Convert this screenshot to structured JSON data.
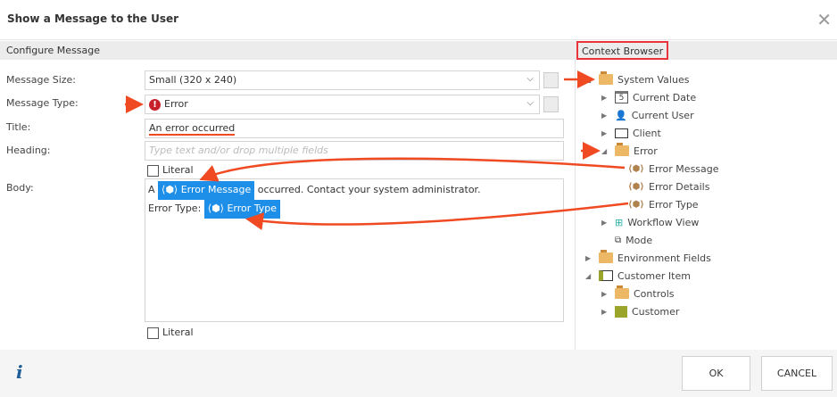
{
  "dialog": {
    "title": "Show a Message to the User"
  },
  "configure": {
    "section_label": "Configure Message",
    "message_size": {
      "label": "Message Size:",
      "value": "Small (320 x 240)"
    },
    "message_type": {
      "label": "Message Type:",
      "value": "Error"
    },
    "title": {
      "label": "Title:",
      "value": "An error occurred"
    },
    "heading": {
      "label": "Heading:",
      "placeholder": "Type text and/or drop multiple fields"
    },
    "literal_label": "Literal",
    "body": {
      "label": "Body:",
      "line1_prefix": "A",
      "token1": "Error Message",
      "line1_suffix": "occurred. Contact your system administrator.",
      "line2_prefix": "Error Type:",
      "token2": "Error Type"
    }
  },
  "context_browser": {
    "label": "Context Browser",
    "items": [
      {
        "label": "System Values",
        "icon": "folder-icon"
      },
      {
        "label": "Current Date",
        "icon": "calendar-icon"
      },
      {
        "label": "Current User",
        "icon": "user-folder-icon"
      },
      {
        "label": "Client",
        "icon": "monitor-icon"
      },
      {
        "label": "Error",
        "icon": "folder-icon"
      },
      {
        "label": "Error Message",
        "icon": "property-icon"
      },
      {
        "label": "Error Details",
        "icon": "property-icon"
      },
      {
        "label": "Error Type",
        "icon": "property-icon"
      },
      {
        "label": "Workflow View",
        "icon": "workflow-icon"
      },
      {
        "label": "Mode",
        "icon": "mode-icon"
      },
      {
        "label": "Environment Fields",
        "icon": "folder-icon"
      },
      {
        "label": "Customer Item",
        "icon": "form-icon"
      },
      {
        "label": "Controls",
        "icon": "folder-icon"
      },
      {
        "label": "Customer",
        "icon": "smartobject-icon"
      }
    ]
  },
  "footer": {
    "info_label": "i",
    "ok_label": "OK",
    "cancel_label": "CANCEL"
  },
  "colors": {
    "accent": "#1e8fe8",
    "annotation": "#f04a23",
    "error": "#c8202a"
  }
}
